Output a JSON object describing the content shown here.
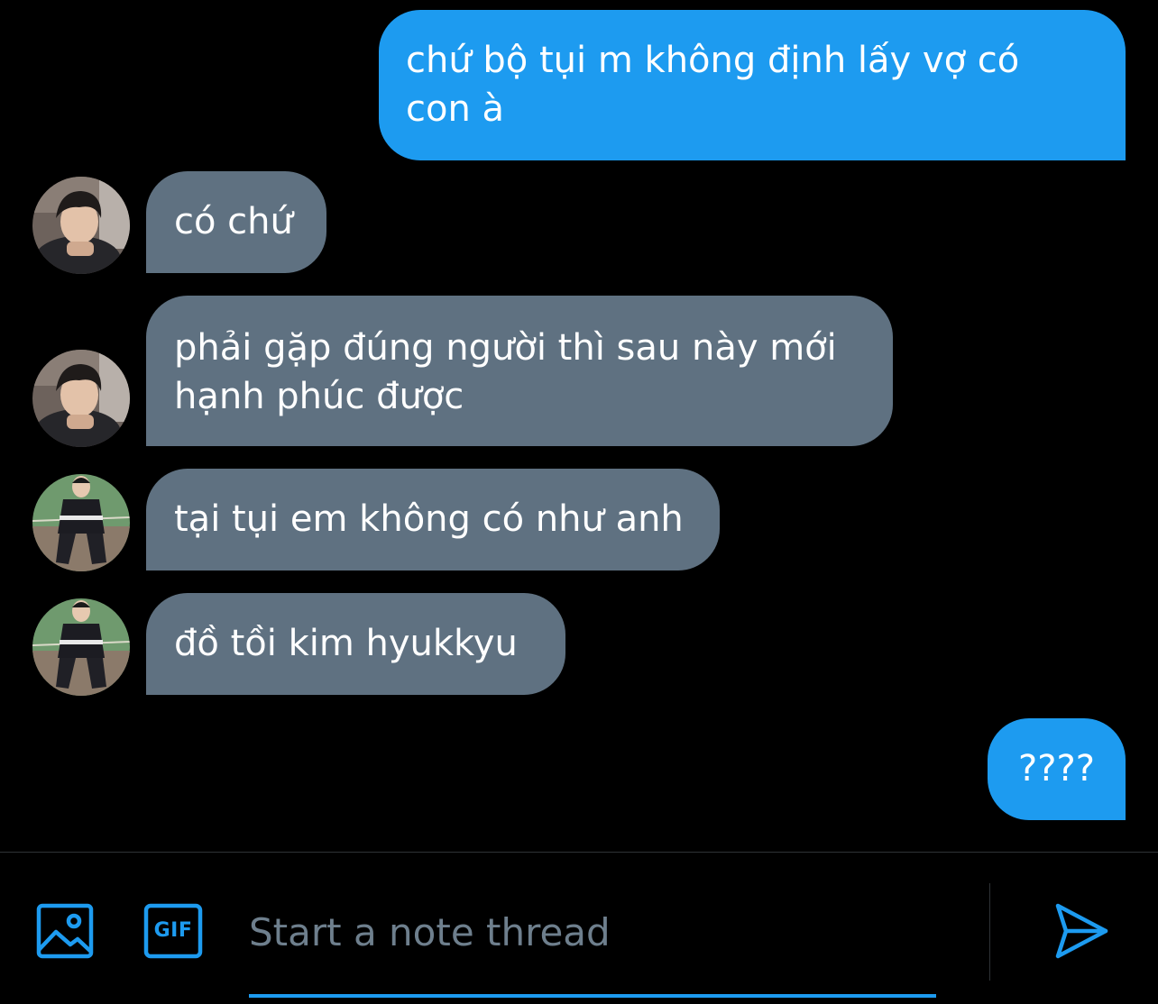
{
  "messages": [
    {
      "direction": "out",
      "text": "chứ bộ tụi m không định lấy vợ có\ncon à"
    },
    {
      "direction": "in",
      "avatar": "avatar-1",
      "text": "có chứ"
    },
    {
      "direction": "in",
      "avatar": "avatar-1",
      "text": "phải gặp đúng người thì sau này mới\nhạnh phúc được"
    },
    {
      "direction": "in",
      "avatar": "avatar-2",
      "text": "tại tụi em không có như anh"
    },
    {
      "direction": "in",
      "avatar": "avatar-2",
      "text": "đồ tồi kim hyukkyu"
    },
    {
      "direction": "out",
      "text": "????"
    }
  ],
  "composer": {
    "image_icon": "image-icon",
    "gif_label": "GIF",
    "placeholder": "Start a note thread",
    "value": "",
    "send_icon": "send-icon"
  },
  "colors": {
    "outgoing_bubble": "#1d9bf0",
    "incoming_bubble": "#5f7181",
    "accent": "#1d9bf0",
    "background": "#000000",
    "placeholder": "#6e7f8d"
  }
}
